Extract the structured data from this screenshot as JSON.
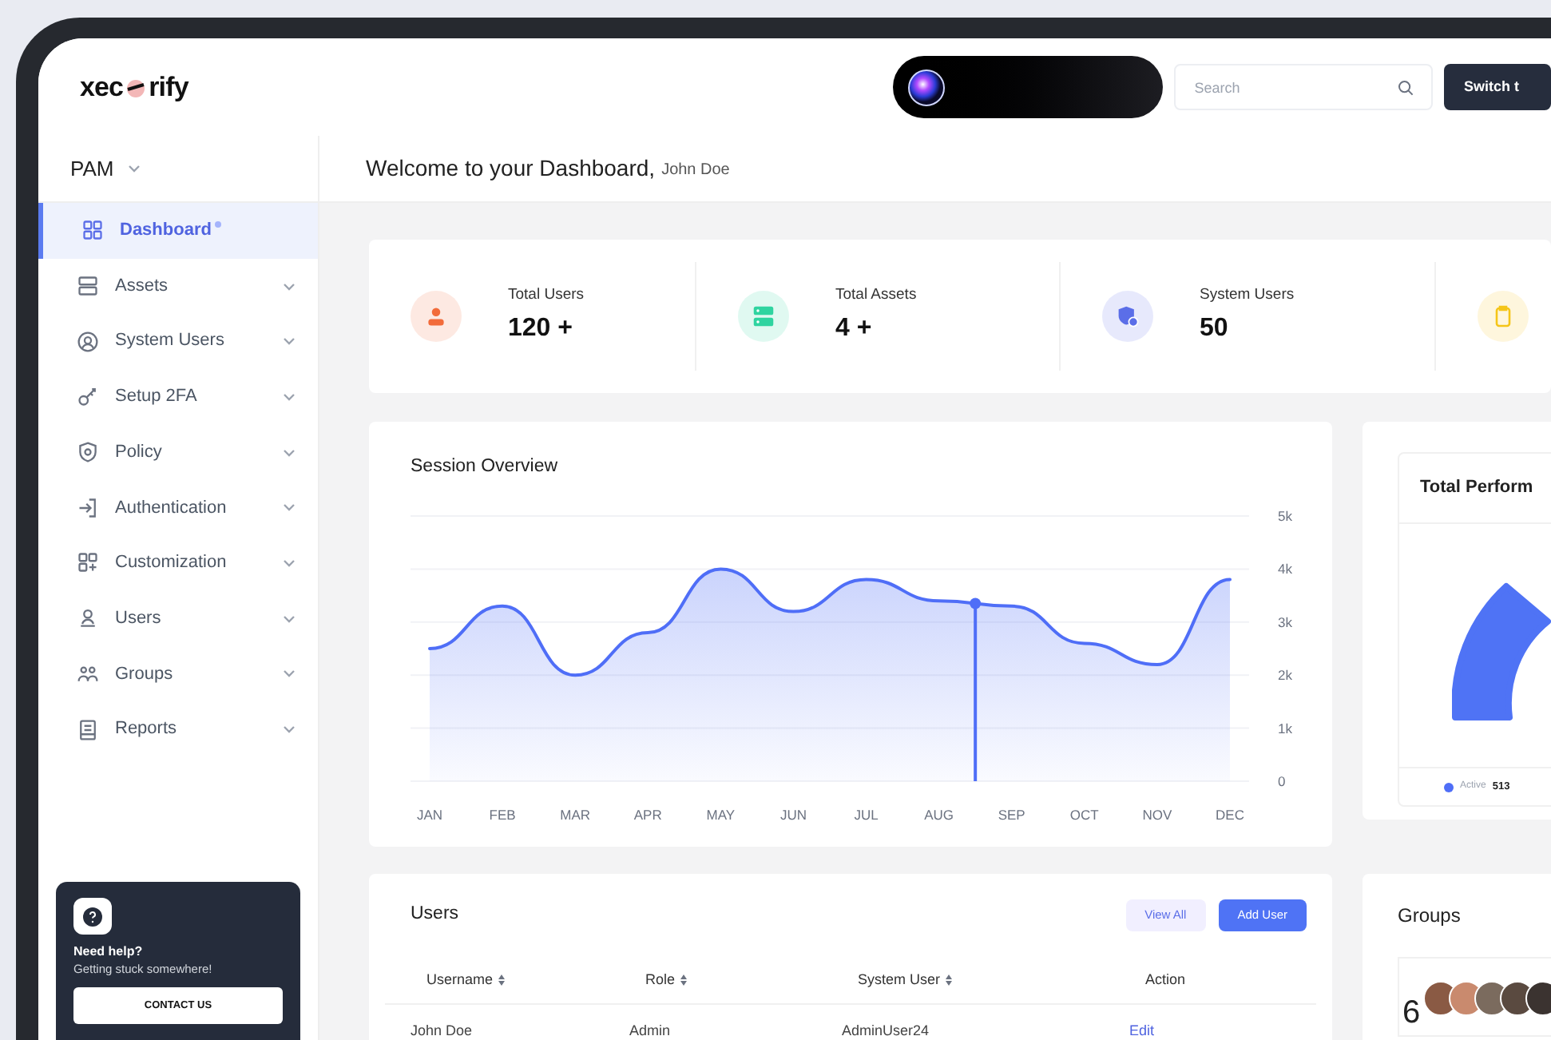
{
  "header": {
    "logo": "xec",
    "logo_rest": "rify",
    "search": {
      "placeholder": "Search"
    },
    "switch_button": "Switch t"
  },
  "sidebar": {
    "workspace": "PAM",
    "items": [
      {
        "label": "Dashboard",
        "kind": "grid",
        "selected": true,
        "expandable": false
      },
      {
        "label": "Assets",
        "kind": "server",
        "selected": false,
        "expandable": true
      },
      {
        "label": "System Users",
        "kind": "user-circle",
        "selected": false,
        "expandable": true
      },
      {
        "label": "Setup 2FA",
        "kind": "key",
        "selected": false,
        "expandable": true
      },
      {
        "label": "Policy",
        "kind": "shield",
        "selected": false,
        "expandable": true
      },
      {
        "label": "Authentication",
        "kind": "login",
        "selected": false,
        "expandable": true
      },
      {
        "label": "Customization",
        "kind": "grid-plus",
        "selected": false,
        "expandable": true
      },
      {
        "label": "Users",
        "kind": "user",
        "selected": false,
        "expandable": true
      },
      {
        "label": "Groups",
        "kind": "group",
        "selected": false,
        "expandable": true
      },
      {
        "label": "Reports",
        "kind": "report",
        "selected": false,
        "expandable": true
      }
    ],
    "help": {
      "title": "Need help?",
      "subtitle": "Getting stuck somewhere!",
      "button": "CONTACT US"
    }
  },
  "welcome": {
    "title": "Welcome to your Dashboard,",
    "name": "John Doe"
  },
  "stats": [
    {
      "kind": "user",
      "color": "#f26b3a",
      "label": "Total Users",
      "value": "120 +"
    },
    {
      "kind": "server",
      "color": "#2fd4a0",
      "label": "Total Assets",
      "value": "4 +"
    },
    {
      "kind": "shield",
      "color": "#5b6ee8",
      "label": "System Users",
      "value": "50"
    },
    {
      "kind": "clipboard",
      "color": "#f5c518"
    }
  ],
  "session_overview": {
    "title": "Session Overview",
    "chart_data": {
      "type": "area",
      "categories": [
        "JAN",
        "FEB",
        "MAR",
        "APR",
        "MAY",
        "JUN",
        "JUL",
        "AUG",
        "SEP",
        "OCT",
        "NOV",
        "DEC"
      ],
      "series": [
        {
          "color": "#4f6ef7",
          "values": [
            2500,
            3300,
            2000,
            2800,
            4000,
            3200,
            3800,
            3400,
            3300,
            2600,
            2200,
            3800
          ]
        }
      ],
      "grid": true,
      "ylim": [
        0,
        5000
      ],
      "yticks": [
        {
          "value": 0,
          "label": "0"
        },
        {
          "value": 1000,
          "label": "1k"
        },
        {
          "value": 2000,
          "label": "2k"
        },
        {
          "value": 3000,
          "label": "3k"
        },
        {
          "value": 4000,
          "label": "4k"
        },
        {
          "value": 5000,
          "label": "5k"
        }
      ]
    }
  },
  "performance": {
    "title": "Total Perform",
    "legend": [
      {
        "label": "Active",
        "value": "513",
        "color": "#4f6ef7"
      }
    ]
  },
  "users": {
    "title": "Users",
    "buttons": [
      {
        "label": "View All",
        "kind": "secondary"
      },
      {
        "label": "Add User",
        "kind": "primary"
      }
    ],
    "columns": [
      {
        "label": "Username",
        "sortable": true
      },
      {
        "label": "Role",
        "sortable": true
      },
      {
        "label": "System User",
        "sortable": true
      },
      {
        "label": "Action",
        "sortable": false
      }
    ],
    "rows": [
      [
        "John Doe",
        "Admin",
        "AdminUser24",
        "Edit"
      ]
    ]
  },
  "groups": {
    "title": "Groups",
    "count": "6"
  }
}
